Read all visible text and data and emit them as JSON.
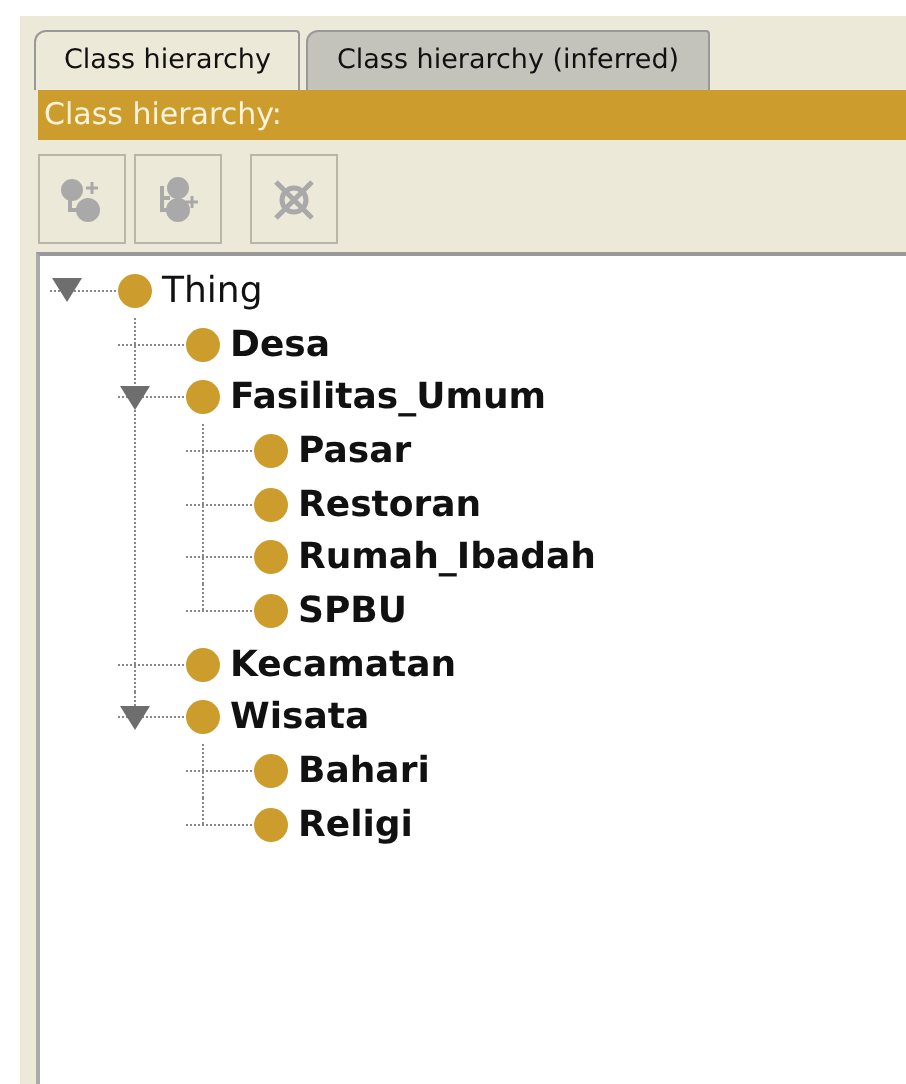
{
  "tabs": [
    {
      "label": "Class hierarchy",
      "selected": true
    },
    {
      "label": "Class hierarchy (inferred)",
      "selected": false
    }
  ],
  "header": {
    "title": "Class hierarchy:"
  },
  "toolbar": [
    {
      "kind": "add-subclass",
      "disabled": true
    },
    {
      "kind": "add-sibling",
      "disabled": true
    },
    {
      "kind": "delete",
      "disabled": true
    }
  ],
  "tree": [
    {
      "label": "Thing",
      "expanded": true,
      "children": [
        {
          "label": "Desa"
        },
        {
          "label": "Fasilitas_Umum",
          "expanded": true,
          "children": [
            {
              "label": "Pasar"
            },
            {
              "label": "Restoran"
            },
            {
              "label": "Rumah_Ibadah"
            },
            {
              "label": "SPBU"
            }
          ]
        },
        {
          "label": "Kecamatan"
        },
        {
          "label": "Wisata",
          "expanded": true,
          "children": [
            {
              "label": "Bahari"
            },
            {
              "label": "Religi"
            }
          ]
        }
      ]
    }
  ]
}
